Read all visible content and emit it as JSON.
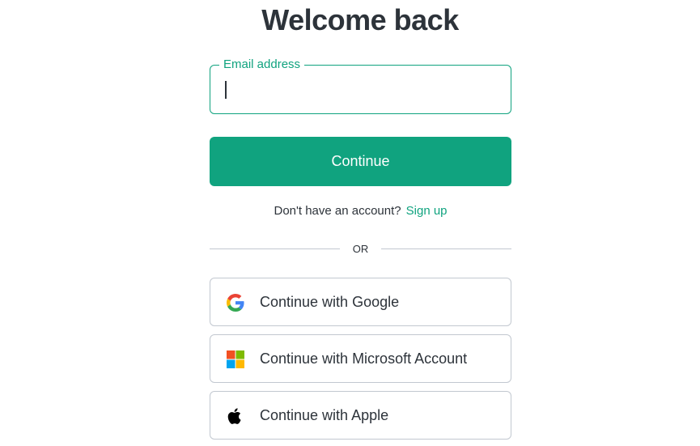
{
  "page": {
    "title": "Welcome back"
  },
  "email": {
    "label": "Email address",
    "value": "",
    "placeholder": ""
  },
  "actions": {
    "continue_label": "Continue"
  },
  "signup": {
    "prompt": "Don't have an account?",
    "link_label": "Sign up"
  },
  "divider": {
    "label": "OR"
  },
  "social": {
    "google_label": "Continue with Google",
    "microsoft_label": "Continue with Microsoft Account",
    "apple_label": "Continue with Apple"
  },
  "icons": {
    "google": "google-logo-icon",
    "microsoft": "microsoft-logo-icon",
    "apple": "apple-logo-icon"
  },
  "colors": {
    "accent": "#10a37f",
    "text": "#2d333a",
    "border": "#c2c8d0",
    "background": "#ffffff"
  }
}
